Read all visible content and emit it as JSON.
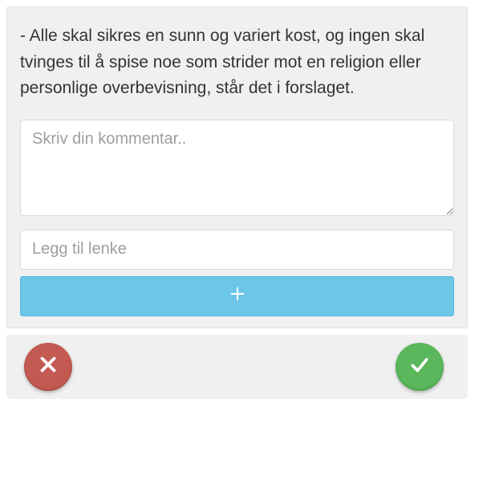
{
  "proposal": {
    "text": "- Alle skal sikres en sunn og variert kost, og ingen skal tvinges til å spise noe som strider mot en religion eller personlige overbevisning, står det i forslaget."
  },
  "comment": {
    "placeholder": "Skriv din kommentar..",
    "value": ""
  },
  "link": {
    "placeholder": "Legg til lenke",
    "value": ""
  },
  "icons": {
    "plus": "plus-icon",
    "close": "close-icon",
    "check": "check-icon"
  },
  "colors": {
    "card_bg": "#f0f0f0",
    "add_btn": "#6cc6e8",
    "reject_btn": "#c35a52",
    "accept_btn": "#5bb75b"
  }
}
